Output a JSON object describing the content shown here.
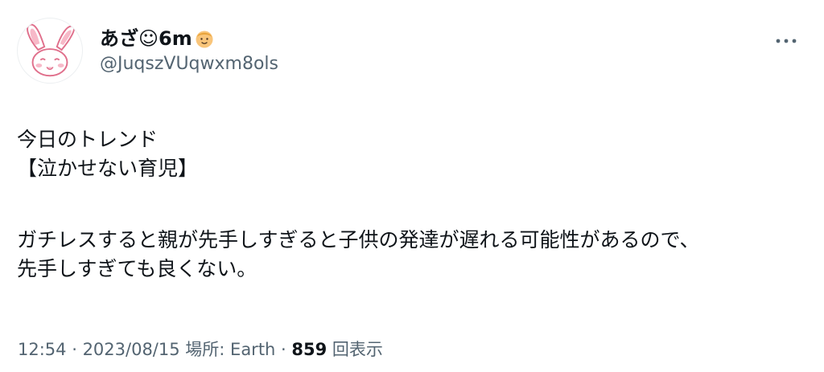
{
  "author": {
    "display_name": "あざ☺6m",
    "badge_emoji": "baby-face-emoji",
    "handle": "@JuqszVUqwxm8ols",
    "avatar": "bunny-avatar-icon"
  },
  "menu": {
    "more_icon": "more-options-icon"
  },
  "tweet": {
    "lines": [
      "今日のトレンド",
      "【泣かせない育児】",
      "ガチレスすると親が先手しすぎると子供の発達が遅れる可能性があるので、",
      "先手しすぎても良くない。"
    ]
  },
  "meta": {
    "time": "12:54",
    "sep1": " · ",
    "date": "2023/08/15",
    "place_label": " 場所: ",
    "place": "Earth",
    "sep2": " · ",
    "views": "859",
    "views_label": " 回表示"
  },
  "colors": {
    "text": "#0f1419",
    "secondary": "#536471",
    "avatar_pink": "#e0708c"
  }
}
